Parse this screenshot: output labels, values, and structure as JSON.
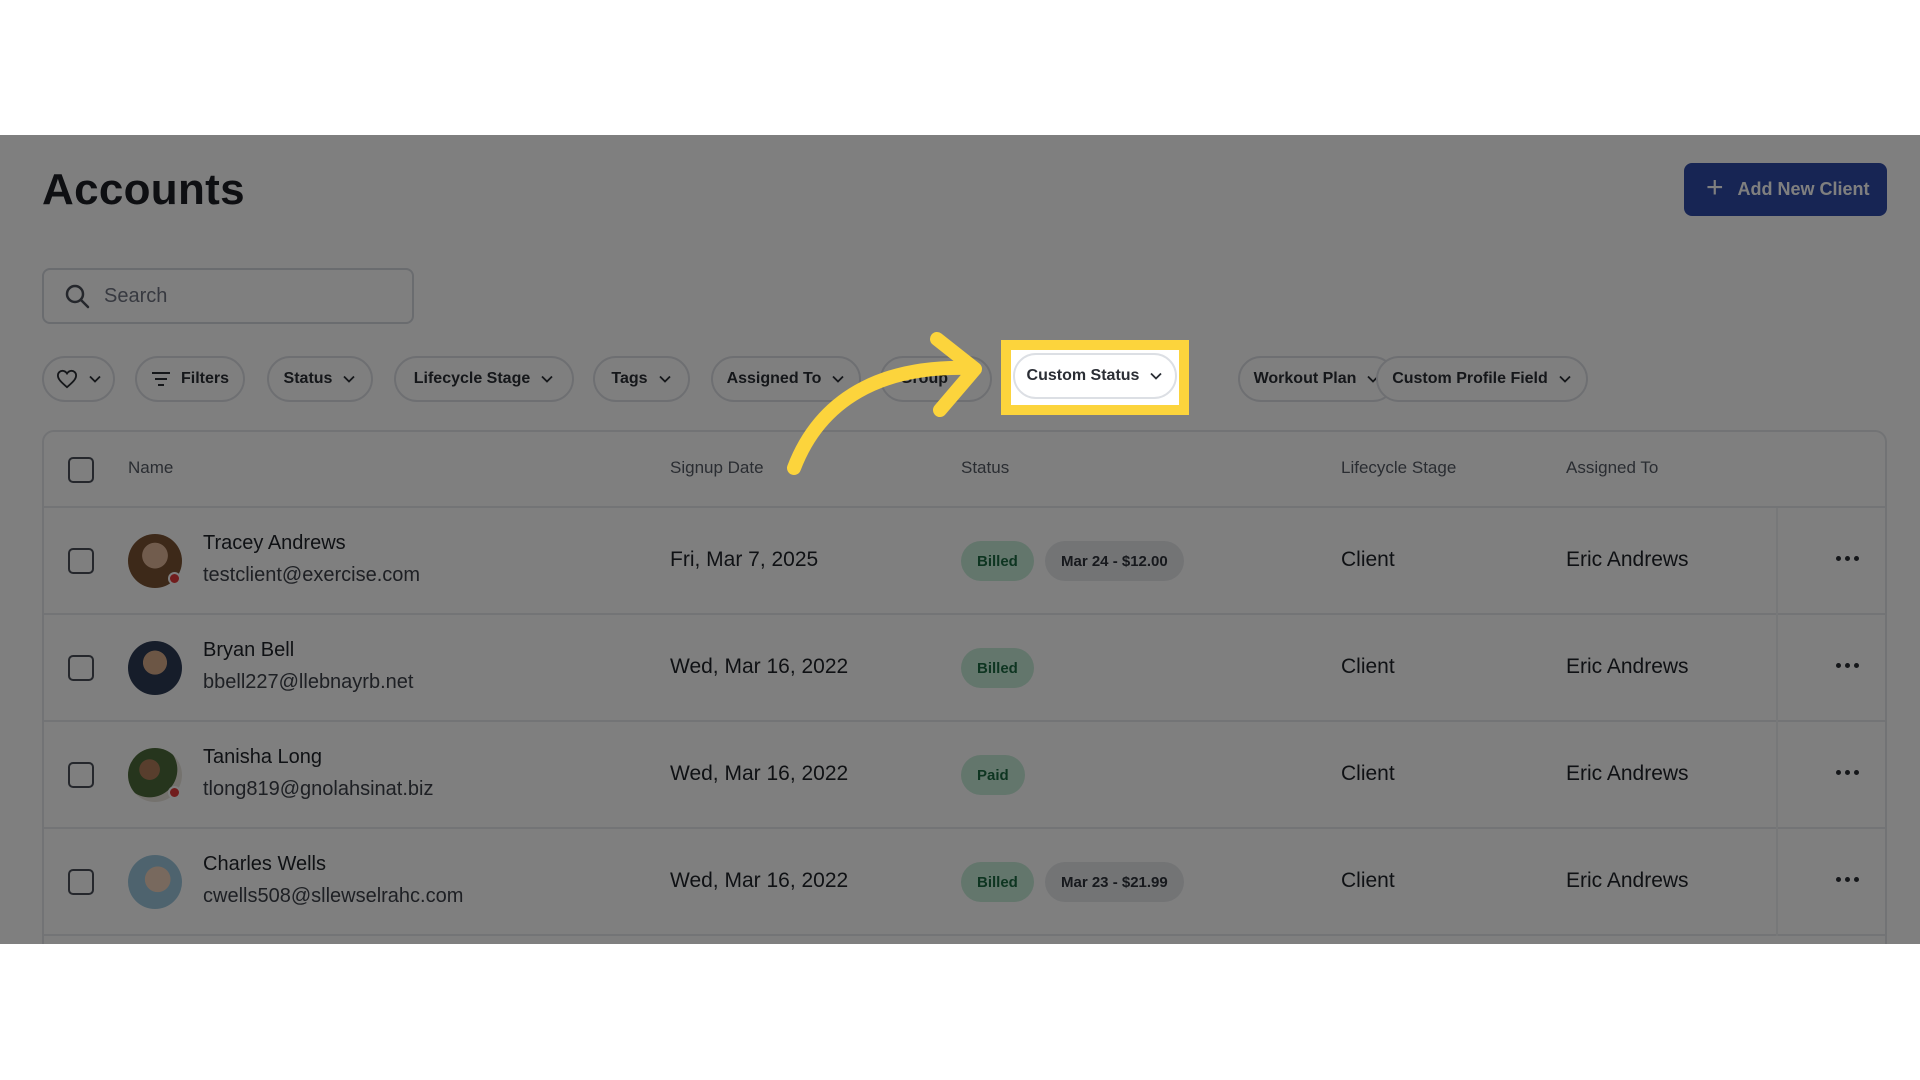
{
  "page": {
    "title": "Accounts",
    "add_button_label": "Add New Client",
    "search_placeholder": "Search"
  },
  "filters": {
    "filters_label": "Filters",
    "chips": [
      "Status",
      "Lifecycle Stage",
      "Tags",
      "Assigned To",
      "Group",
      "Custom Status",
      "Workout Plan",
      "Custom Profile Field"
    ]
  },
  "table": {
    "columns": [
      "Name",
      "Signup Date",
      "Status",
      "Lifecycle Stage",
      "Assigned To"
    ],
    "rows": [
      {
        "name": "Tracey Andrews",
        "email": "testclient@exercise.com",
        "signup_date": "Fri, Mar 7, 2025",
        "status": "Billed",
        "extra": "Mar 24 - $12.00",
        "lifecycle_stage": "Client",
        "assigned_to": "Eric Andrews",
        "online_dot": true
      },
      {
        "name": "Bryan Bell",
        "email": "bbell227@llebnayrb.net",
        "signup_date": "Wed, Mar 16, 2022",
        "status": "Billed",
        "extra": "",
        "lifecycle_stage": "Client",
        "assigned_to": "Eric Andrews",
        "online_dot": false
      },
      {
        "name": "Tanisha Long",
        "email": "tlong819@gnolahsinat.biz",
        "signup_date": "Wed, Mar 16, 2022",
        "status": "Paid",
        "extra": "",
        "lifecycle_stage": "Client",
        "assigned_to": "Eric Andrews",
        "online_dot": true
      },
      {
        "name": "Charles Wells",
        "email": "cwells508@sllewselrahc.com",
        "signup_date": "Wed, Mar 16, 2022",
        "status": "Billed",
        "extra": "Mar 23 - $21.99",
        "lifecycle_stage": "Client",
        "assigned_to": "Eric Andrews",
        "online_dot": false
      }
    ]
  },
  "annotation": {
    "highlighted_chip": "Custom Status",
    "highlight_color": "#fcd43c"
  },
  "colors": {
    "primary": "#2e4ba8",
    "billed_bg": "#c6ecd8",
    "billed_text": "#1c6a43",
    "status_dot": "#e23a3a"
  }
}
